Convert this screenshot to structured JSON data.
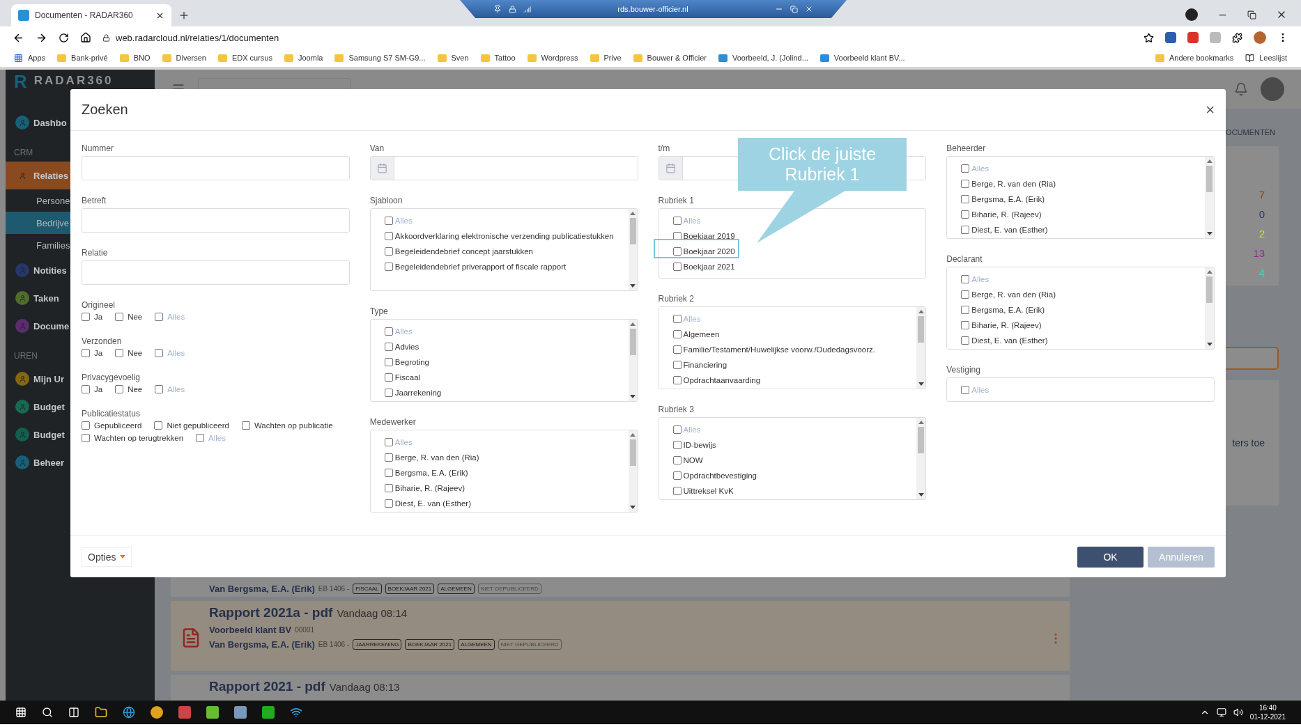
{
  "browser": {
    "tabs": [
      {
        "title": "Documenten - RADAR360",
        "selected": true
      }
    ],
    "remote_bar": {
      "host": "rds.bouwer-officier.nl"
    },
    "address": "web.radarcloud.nl/relaties/1/documenten",
    "bookmarks": [
      {
        "label": "Apps",
        "kind": "apps"
      },
      {
        "label": "Bank-privé",
        "kind": "folder"
      },
      {
        "label": "BNO",
        "kind": "folder"
      },
      {
        "label": "Diversen",
        "kind": "folder"
      },
      {
        "label": "EDX cursus",
        "kind": "folder"
      },
      {
        "label": "Joomla",
        "kind": "folder"
      },
      {
        "label": "Samsung S7 SM-G9...",
        "kind": "folder"
      },
      {
        "label": "Sven",
        "kind": "folder"
      },
      {
        "label": "Tattoo",
        "kind": "folder"
      },
      {
        "label": "Wordpress",
        "kind": "folder"
      },
      {
        "label": "Prive",
        "kind": "folder"
      },
      {
        "label": "Bouwer & Officier",
        "kind": "folder"
      },
      {
        "label": "Voorbeeld, J. (Jolind...",
        "kind": "site"
      },
      {
        "label": "Voorbeeld klant BV...",
        "kind": "site"
      }
    ],
    "bookmarks_right": [
      {
        "label": "Andere bookmarks",
        "kind": "folder"
      },
      {
        "label": "Leeslijst",
        "kind": "list"
      }
    ]
  },
  "app": {
    "logo_mark": "R",
    "logo": "RADAR360",
    "sidebar": [
      {
        "kind": "item",
        "label": "Dashbo",
        "color": "#17607a",
        "selected": false
      },
      {
        "kind": "section",
        "label": "CRM"
      },
      {
        "kind": "item",
        "label": "Relaties",
        "color": "#8a4a1f",
        "selected": true
      },
      {
        "kind": "sub",
        "label": "Persone",
        "selected": false
      },
      {
        "kind": "sub",
        "label": "Bedrijve",
        "selected": true
      },
      {
        "kind": "sub",
        "label": "Families",
        "selected": false
      },
      {
        "kind": "item",
        "label": "Notities",
        "color": "#26386a",
        "selected": false
      },
      {
        "kind": "item",
        "label": "Taken",
        "color": "#506e2a",
        "selected": false
      },
      {
        "kind": "item",
        "label": "Docume",
        "color": "#5c2c6e",
        "selected": false
      },
      {
        "kind": "section",
        "label": "UREN"
      },
      {
        "kind": "item",
        "label": "Mijn Ur",
        "color": "#85680f",
        "selected": false
      },
      {
        "kind": "item",
        "label": "Budget",
        "color": "#166a52",
        "selected": false
      },
      {
        "kind": "item",
        "label": "Budget",
        "color": "#12604f",
        "selected": false
      },
      {
        "kind": "item",
        "label": "Beheer",
        "color": "#17607a",
        "selected": false
      }
    ],
    "tab_label": "OCUMENTEN",
    "stats": [
      {
        "value": "7",
        "color": "#9a3c00"
      },
      {
        "value": "0",
        "color": "#2c3a5e"
      },
      {
        "value": "2",
        "color": "#c8e03a"
      },
      {
        "value": "13",
        "color": "#8e2c8e"
      },
      {
        "value": "4",
        "color": "#28e0c4"
      }
    ],
    "hint": "ters toe",
    "documents": [
      {
        "author": "Van Bergsma, E.A. (Erik)",
        "code": "EB 1406 -",
        "tags": [
          {
            "label": "FISCAAL",
            "muted": false
          },
          {
            "label": "BOEKJAAR 2021",
            "muted": false
          },
          {
            "label": "ALGEMEEN",
            "muted": false
          },
          {
            "label": "NIET GEPUBLICEERD",
            "muted": true
          }
        ]
      },
      {
        "title": "Rapport 2021a - pdf",
        "time": "Vandaag 08:14",
        "client": "Voorbeeld klant BV",
        "client_no": "00001",
        "author": "Van Bergsma, E.A. (Erik)",
        "code": "EB 1406 -",
        "tags": [
          {
            "label": "JAARREKENING",
            "muted": false
          },
          {
            "label": "BOEKJAAR 2021",
            "muted": false
          },
          {
            "label": "ALGEMEEN",
            "muted": false
          },
          {
            "label": "NIET GEPUBLICEERD",
            "muted": true
          }
        ]
      },
      {
        "title": "Rapport 2021 - pdf",
        "time": "Vandaag 08:13"
      }
    ]
  },
  "dialog": {
    "title": "Zoeken",
    "close": "×",
    "columns": [
      [
        {
          "kind": "input",
          "label": "Nummer"
        },
        {
          "kind": "input",
          "label": "Betreft"
        },
        {
          "kind": "input",
          "label": "Relatie"
        },
        {
          "kind": "checks",
          "label": "Origineel",
          "options": [
            {
              "label": "Ja",
              "checked": false,
              "muted": false
            },
            {
              "label": "Nee",
              "checked": false,
              "muted": false
            },
            {
              "label": "Alles",
              "checked": false,
              "muted": true
            }
          ]
        },
        {
          "kind": "checks",
          "label": "Verzonden",
          "options": [
            {
              "label": "Ja",
              "checked": false,
              "muted": false
            },
            {
              "label": "Nee",
              "checked": false,
              "muted": false
            },
            {
              "label": "Alles",
              "checked": false,
              "muted": true
            }
          ]
        },
        {
          "kind": "checks",
          "label": "Privacygevoelig",
          "options": [
            {
              "label": "Ja",
              "checked": false,
              "muted": false
            },
            {
              "label": "Nee",
              "checked": false,
              "muted": false
            },
            {
              "label": "Alles",
              "checked": false,
              "muted": true
            }
          ]
        },
        {
          "kind": "checks",
          "label": "Publicatiestatus",
          "options": [
            {
              "label": "Gepubliceerd",
              "checked": false,
              "muted": false
            },
            {
              "label": "Niet gepubliceerd",
              "checked": false,
              "muted": false
            },
            {
              "label": "Wachten op publicatie",
              "checked": false,
              "muted": false
            },
            {
              "label": "Wachten op terugtrekken",
              "checked": false,
              "muted": false
            },
            {
              "label": "Alles",
              "checked": false,
              "muted": true
            }
          ]
        }
      ],
      [
        {
          "kind": "date",
          "label": "Van"
        },
        {
          "kind": "list",
          "label": "Sjabloon",
          "scrollable": true,
          "options": [
            {
              "label": "Alles",
              "checked": false,
              "muted": true
            },
            {
              "label": "Akkoordverklaring elektronische verzending publicatiestukken",
              "checked": false,
              "muted": false
            },
            {
              "label": "Begeleidendebrief concept jaarstukken",
              "checked": false,
              "muted": false
            },
            {
              "label": "Begeleidendebrief priverapport of fiscale rapport",
              "checked": false,
              "muted": false
            }
          ]
        },
        {
          "kind": "list",
          "label": "Type",
          "scrollable": true,
          "options": [
            {
              "label": "Alles",
              "checked": false,
              "muted": true
            },
            {
              "label": "Advies",
              "checked": false,
              "muted": false
            },
            {
              "label": "Begroting",
              "checked": false,
              "muted": false
            },
            {
              "label": "Fiscaal",
              "checked": false,
              "muted": false
            },
            {
              "label": "Jaarrekening",
              "checked": false,
              "muted": false
            }
          ]
        },
        {
          "kind": "list",
          "label": "Medewerker",
          "scrollable": true,
          "options": [
            {
              "label": "Alles",
              "checked": false,
              "muted": true
            },
            {
              "label": "Berge, R. van den (Ria)",
              "checked": false,
              "muted": false
            },
            {
              "label": "Bergsma, E.A. (Erik)",
              "checked": false,
              "muted": false
            },
            {
              "label": "Biharie, R. (Rajeev)",
              "checked": false,
              "muted": false
            },
            {
              "label": "Diest, E. van (Esther)",
              "checked": false,
              "muted": false
            }
          ]
        }
      ],
      [
        {
          "kind": "date",
          "label": "t/m"
        },
        {
          "kind": "list",
          "label": "Rubriek 1",
          "scrollable": false,
          "options": [
            {
              "label": "Alles",
              "checked": false,
              "muted": true
            },
            {
              "label": "Boekjaar 2019",
              "checked": false,
              "muted": false
            },
            {
              "label": "Boekjaar 2020",
              "checked": false,
              "muted": false
            },
            {
              "label": "Boekjaar 2021",
              "checked": false,
              "muted": false
            }
          ]
        },
        {
          "kind": "list",
          "label": "Rubriek 2",
          "scrollable": true,
          "options": [
            {
              "label": "Alles",
              "checked": false,
              "muted": true
            },
            {
              "label": "Algemeen",
              "checked": false,
              "muted": false
            },
            {
              "label": "Familie/Testament/Huwelijkse voorw./Oudedagsvoorz.",
              "checked": false,
              "muted": false
            },
            {
              "label": "Financiering",
              "checked": false,
              "muted": false
            },
            {
              "label": "Opdrachtaanvaarding",
              "checked": false,
              "muted": false
            }
          ]
        },
        {
          "kind": "list",
          "label": "Rubriek 3",
          "scrollable": true,
          "options": [
            {
              "label": "Alles",
              "checked": false,
              "muted": true
            },
            {
              "label": "ID-bewijs",
              "checked": false,
              "muted": false
            },
            {
              "label": "NOW",
              "checked": false,
              "muted": false
            },
            {
              "label": "Opdrachtbevestiging",
              "checked": false,
              "muted": false
            },
            {
              "label": "Uittreksel KvK",
              "checked": false,
              "muted": false
            }
          ]
        }
      ],
      [
        {
          "kind": "list",
          "label": "Beheerder",
          "scrollable": true,
          "options": [
            {
              "label": "Alles",
              "checked": false,
              "muted": true
            },
            {
              "label": "Berge, R. van den (Ria)",
              "checked": false,
              "muted": false
            },
            {
              "label": "Bergsma, E.A. (Erik)",
              "checked": false,
              "muted": false
            },
            {
              "label": "Biharie, R. (Rajeev)",
              "checked": false,
              "muted": false
            },
            {
              "label": "Diest, E. van (Esther)",
              "checked": false,
              "muted": false
            }
          ]
        },
        {
          "kind": "list",
          "label": "Declarant",
          "scrollable": true,
          "options": [
            {
              "label": "Alles",
              "checked": false,
              "muted": true
            },
            {
              "label": "Berge, R. van den (Ria)",
              "checked": false,
              "muted": false
            },
            {
              "label": "Bergsma, E.A. (Erik)",
              "checked": false,
              "muted": false
            },
            {
              "label": "Biharie, R. (Rajeev)",
              "checked": false,
              "muted": false
            },
            {
              "label": "Diest, E. van (Esther)",
              "checked": false,
              "muted": false
            }
          ]
        },
        {
          "kind": "list",
          "label": "Vestiging",
          "scrollable": false,
          "options": [
            {
              "label": "Alles",
              "checked": false,
              "muted": true
            }
          ]
        }
      ]
    ],
    "options_button": "Opties",
    "buttons": [
      {
        "label": "OK",
        "kind": "primary"
      },
      {
        "label": "Annuleren",
        "kind": "secondary"
      }
    ]
  },
  "annotation": {
    "text": "Click de juiste Rubriek 1"
  },
  "taskbar": {
    "time": "16:40",
    "date": "01-12-2021"
  }
}
